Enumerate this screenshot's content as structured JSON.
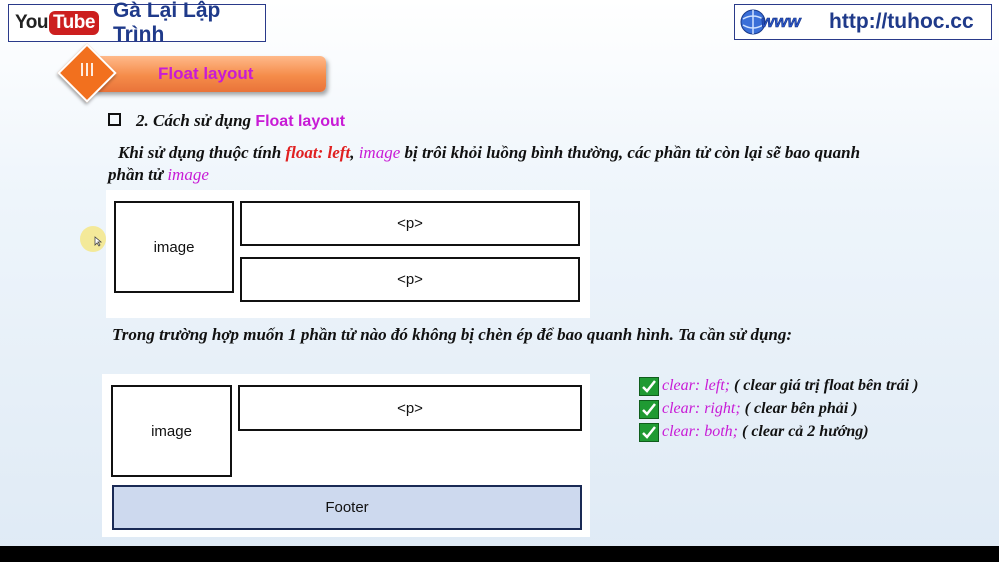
{
  "header": {
    "youtube_you": "You",
    "youtube_tube": "Tube",
    "channel_name": "Gà Lại Lập Trình",
    "www_icon": "www-globe-icon",
    "site_url": "http://tuhoc.cc"
  },
  "section": {
    "number": "III",
    "title": "Float layout"
  },
  "content": {
    "heading_prefix": "2. Cách sử dụng ",
    "heading_highlight": "Float layout",
    "para1_part1": "Khi sử dụng thuộc tính ",
    "para1_code": "float: left",
    "para1_part2": ", ",
    "para1_image": "image",
    "para1_part3": " bị trôi khỏi luồng bình thường, các phần tử còn lại sẽ bao quanh",
    "para1_line2_prefix": "phần tử ",
    "para1_line2_image": "image",
    "para2": "Trong trường hợp muốn 1 phần tử nào đó không bị chèn ép để bao quanh hình. Ta cần sử dụng:"
  },
  "diagram1": {
    "image_label": "image",
    "p1_label": "<p>",
    "p2_label": "<p>"
  },
  "diagram2": {
    "image_label": "image",
    "p_label": "<p>",
    "footer_label": "Footer"
  },
  "clear_options": [
    {
      "code": "clear: left;",
      "desc": " ( clear giá trị float bên trái )"
    },
    {
      "code": "clear: right;",
      "desc": " ( clear bên phải )"
    },
    {
      "code": "clear: both;",
      "desc": " ( clear cả 2 hướng)"
    }
  ],
  "colors": {
    "accent_magenta": "#c81bd6",
    "accent_red": "#e02020",
    "brand_blue": "#1f3a8a",
    "banner_orange": "#f58c4a",
    "check_green": "#1f9a33"
  }
}
